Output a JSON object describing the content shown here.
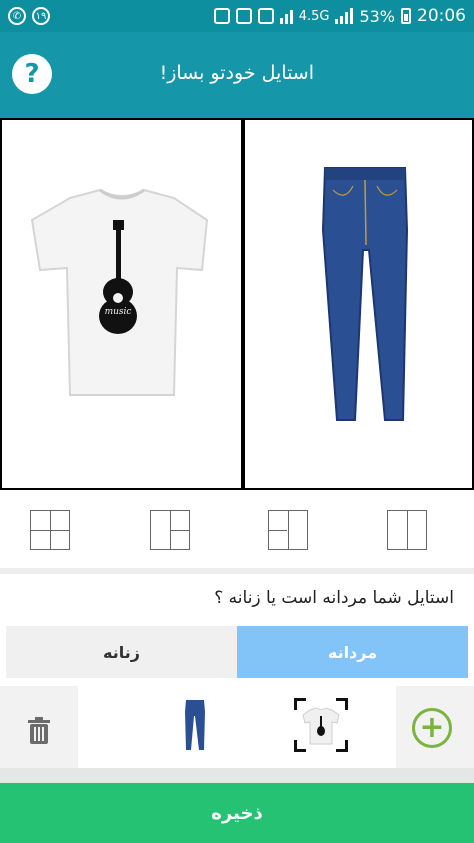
{
  "status_bar": {
    "left_badge": "۱۹",
    "network": "4.5G",
    "battery": "53%",
    "time": "20:06"
  },
  "header": {
    "title": "استایل خودتو بساز!",
    "help_label": "?"
  },
  "canvas": {
    "left_item": "tshirt-guitar-music",
    "right_item": "blue-jeans"
  },
  "layouts": [
    "grid-4",
    "grid-3-right",
    "grid-3-left",
    "grid-2"
  ],
  "question": "استایل شما مردانه است یا زنانه ؟",
  "gender_toggle": {
    "female_label": "زنانه",
    "male_label": "مردانه",
    "selected": "male"
  },
  "tray": {
    "items": [
      "tshirt-guitar-music",
      "blue-jeans"
    ],
    "add_icon": "plus-circle-icon",
    "delete_icon": "trash-icon"
  },
  "save_label": "ذخیره",
  "colors": {
    "status_bar": "#0e8fa0",
    "app_bar": "#1597a9",
    "male_selected": "#82c4f8",
    "save": "#24c272",
    "add": "#7ab33e"
  }
}
